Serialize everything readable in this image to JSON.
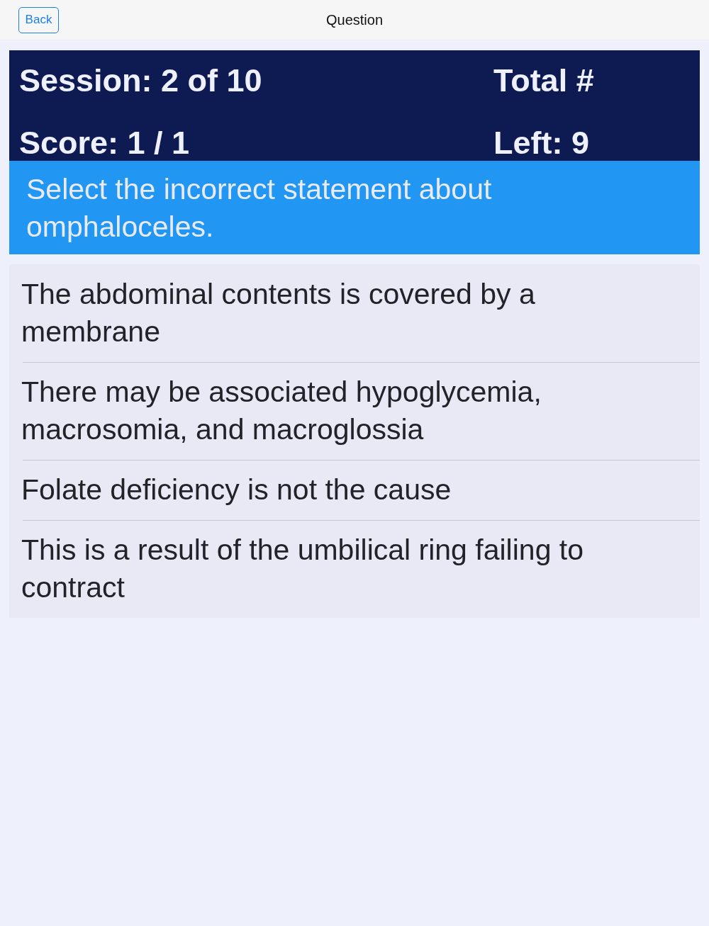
{
  "nav": {
    "back_button": "Back",
    "title": "Question"
  },
  "stats": [
    "Session: 2 of 10",
    "Total #",
    "Score: 1 / 1",
    "Left: 9"
  ],
  "question": "Select the incorrect statement about omphaloceles.",
  "answers": [
    {
      "text": "The abdominal contents is covered by a membrane",
      "selected": false
    },
    {
      "text": "There may be associated hypoglycemia, macrosomia, and macroglossia",
      "selected": false
    },
    {
      "text": "Folate deficiency is not the cause",
      "selected": false
    },
    {
      "text": "This is a result of the umbilical ring failing to contract",
      "selected": false
    }
  ]
}
